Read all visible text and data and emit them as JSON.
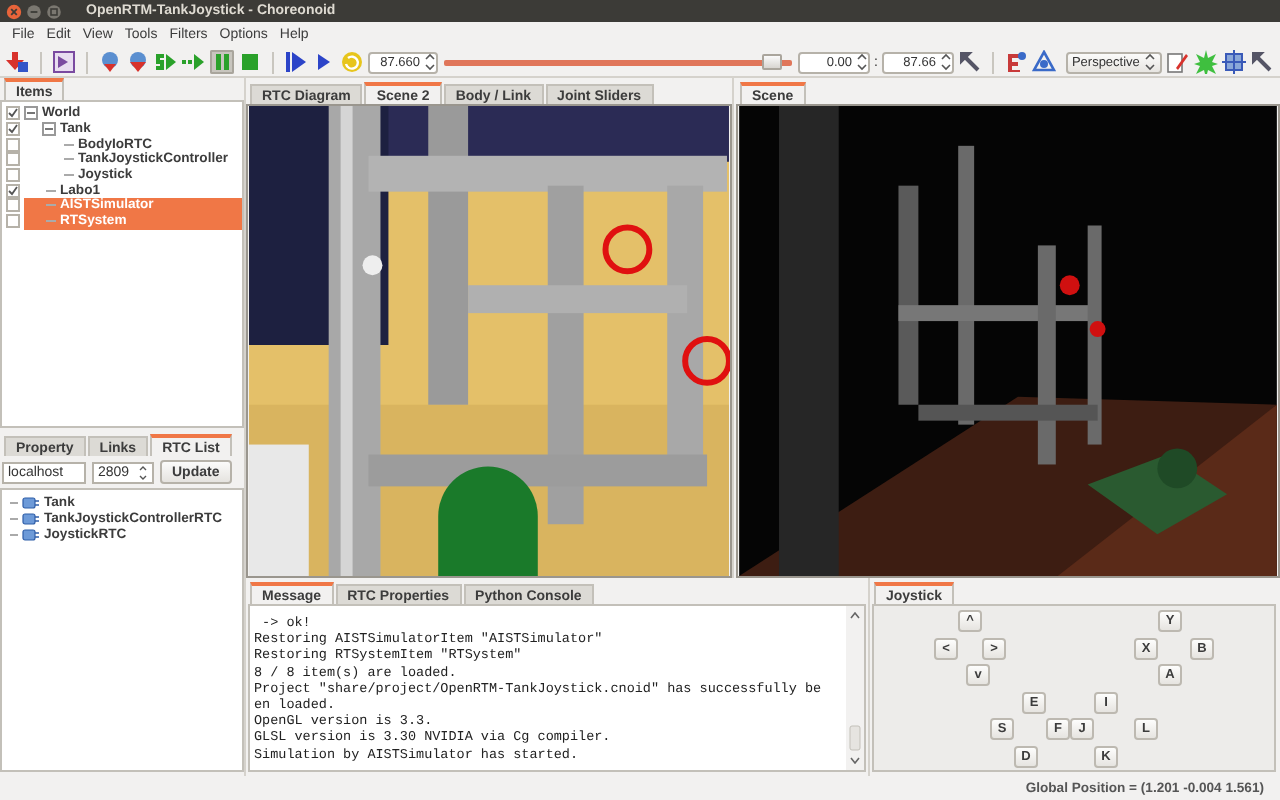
{
  "window": {
    "title": "OpenRTM-TankJoystick - Choreonoid"
  },
  "menu": [
    "File",
    "Edit",
    "View",
    "Tools",
    "Filters",
    "Options",
    "Help"
  ],
  "toolbar": {
    "pause_toggled": true,
    "time": "87.660",
    "time_slider": {
      "level": 0.97
    },
    "start_time": "0.00",
    "separator": ":",
    "end_time": "87.66",
    "view_mode": "Perspective"
  },
  "items_panel": {
    "tabs": [
      {
        "label": "Items",
        "selected": true
      }
    ],
    "tree": [
      {
        "label": "World",
        "checked": true,
        "expanded": true,
        "selected": false,
        "children": [
          {
            "label": "Tank",
            "checked": true,
            "expanded": true,
            "selected": false,
            "children": [
              {
                "label": "BodyIoRTC",
                "checked": false,
                "selected": false
              },
              {
                "label": "TankJoystickController",
                "checked": false,
                "selected": false
              },
              {
                "label": "Joystick",
                "checked": false,
                "selected": false
              }
            ]
          },
          {
            "label": "Labo1",
            "checked": true,
            "selected": false
          },
          {
            "label": "AISTSimulator",
            "checked": false,
            "selected": true
          },
          {
            "label": "RTSystem",
            "checked": false,
            "selected": true
          }
        ]
      }
    ]
  },
  "rtc_panel": {
    "tabs": [
      {
        "label": "Property",
        "selected": false
      },
      {
        "label": "Links",
        "selected": false
      },
      {
        "label": "RTC List",
        "selected": true
      }
    ],
    "host": "localhost",
    "port": "2809",
    "update_button": "Update",
    "components": [
      "Tank",
      "TankJoystickControllerRTC",
      "JoystickRTC"
    ]
  },
  "left_view": {
    "tabs": [
      {
        "label": "RTC Diagram",
        "selected": false
      },
      {
        "label": "Scene 2",
        "selected": true
      },
      {
        "label": "Body / Link",
        "selected": false
      },
      {
        "label": "Joint Sliders",
        "selected": false
      }
    ]
  },
  "right_view": {
    "tabs": [
      {
        "label": "Scene",
        "selected": true
      }
    ]
  },
  "message_panel": {
    "tabs": [
      {
        "label": "Message",
        "selected": true
      },
      {
        "label": "RTC Properties",
        "selected": false
      },
      {
        "label": "Python Console",
        "selected": false
      }
    ],
    "lines": [
      " -> ok!",
      "Restoring AISTSimulatorItem \"AISTSimulator\"",
      "Restoring RTSystemItem \"RTSystem\"",
      "8 / 8 item(s) are loaded.",
      "Project \"share/project/OpenRTM-TankJoystick.cnoid\" has successfully be",
      "en loaded.",
      "OpenGL version is 3.3.",
      "GLSL version is 3.30 NVIDIA via Cg compiler.",
      "Simulation by AISTSimulator has started."
    ]
  },
  "joystick_panel": {
    "tabs": [
      {
        "label": "Joystick",
        "selected": true
      }
    ],
    "buttons": [
      "^",
      "Y",
      "<",
      ">",
      "X",
      "B",
      "v",
      "A",
      "E",
      "I",
      "S",
      "F",
      "J",
      "L",
      "D",
      "K"
    ]
  },
  "status_bar": {
    "text": "Global Position = (1.201 -0.004 1.561)"
  }
}
